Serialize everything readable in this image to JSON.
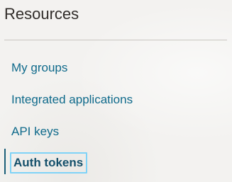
{
  "section": {
    "title": "Resources"
  },
  "nav": {
    "items": [
      {
        "label": "My groups",
        "active": false
      },
      {
        "label": "Integrated applications",
        "active": false
      },
      {
        "label": "API keys",
        "active": false
      },
      {
        "label": "Auth tokens",
        "active": true
      }
    ]
  },
  "colors": {
    "background": "#f3f2f0",
    "heading_text": "#312d2a",
    "link_text": "#0f6a8b",
    "active_text": "#15506b",
    "active_indicator": "#1b5f7a",
    "focus_ring": "#7fd3f7",
    "divider": "#c8c5c0"
  }
}
